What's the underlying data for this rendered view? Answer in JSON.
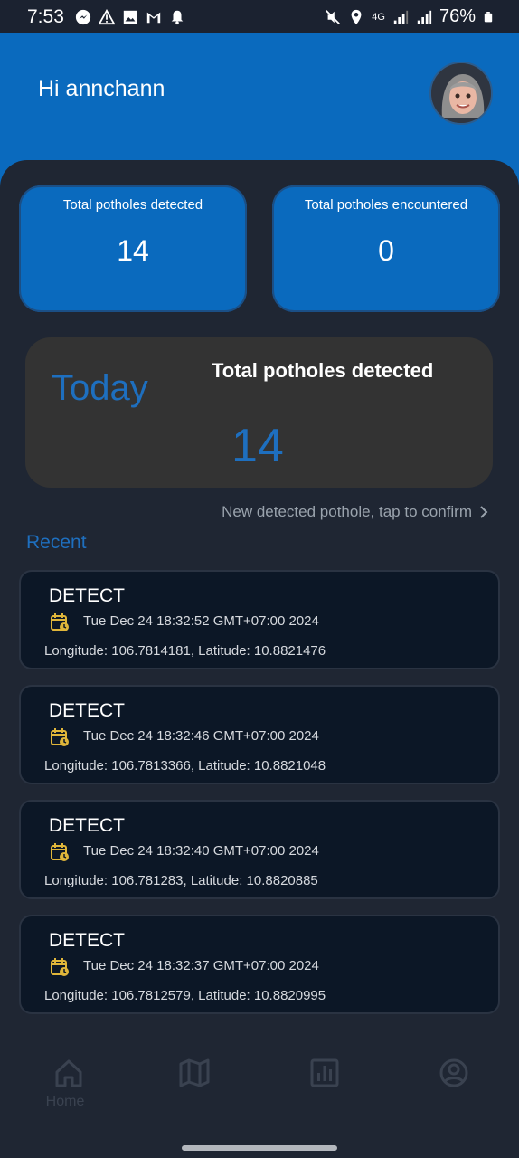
{
  "status_bar": {
    "time": "7:53",
    "battery": "76%",
    "network": "4G"
  },
  "header": {
    "greeting": "Hi annchann"
  },
  "stats": {
    "detected_label": "Total potholes detected",
    "detected_value": "14",
    "encountered_label": "Total potholes encountered",
    "encountered_value": "0"
  },
  "today": {
    "label": "Today",
    "title": "Total potholes detected",
    "value": "14"
  },
  "confirm_link": "New detected pothole, tap to confirm",
  "recent": {
    "title": "Recent",
    "items": [
      {
        "type": "DETECT",
        "date": "Tue Dec 24 18:32:52 GMT+07:00 2024",
        "coords": "Longitude: 106.7814181, Latitude: 10.8821476"
      },
      {
        "type": "DETECT",
        "date": "Tue Dec 24 18:32:46 GMT+07:00 2024",
        "coords": "Longitude: 106.7813366, Latitude: 10.8821048"
      },
      {
        "type": "DETECT",
        "date": "Tue Dec 24 18:32:40 GMT+07:00 2024",
        "coords": "Longitude: 106.781283, Latitude: 10.8820885"
      },
      {
        "type": "DETECT",
        "date": "Tue Dec 24 18:32:37 GMT+07:00 2024",
        "coords": "Longitude: 106.7812579, Latitude: 10.8820995"
      }
    ]
  },
  "nav": {
    "home_label": "Home"
  },
  "colors": {
    "accent": "#0A6ABE",
    "today_blue": "#1E6FBF",
    "calendar_icon": "#E0B63A"
  }
}
